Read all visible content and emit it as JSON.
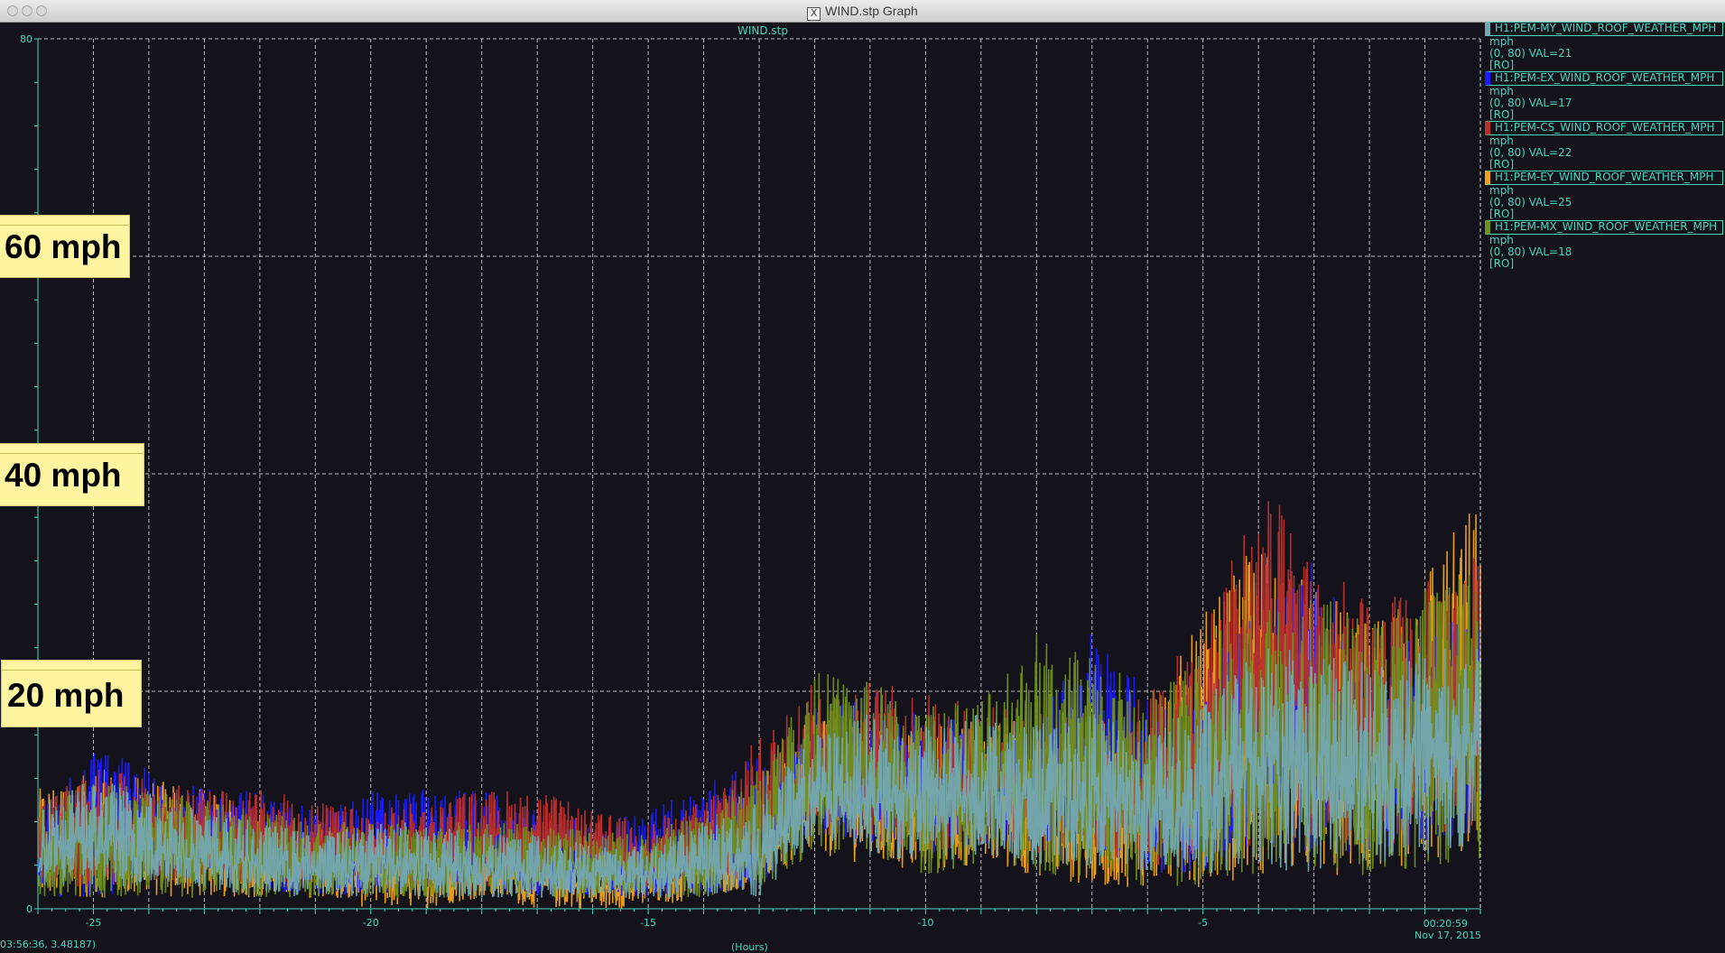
{
  "window": {
    "title": "WIND.stp Graph",
    "x_icon": "X"
  },
  "colors": {
    "background": "#14131c",
    "axis_text": "#48d6bd",
    "grid": "#d8d8d8",
    "series_MY": "#73a8b2",
    "series_EX": "#1a1aff",
    "series_CS": "#b8302c",
    "series_EY": "#f0a21c",
    "series_MX": "#6f8f1e"
  },
  "chart_data": {
    "type": "line",
    "title": "WIND.stp",
    "xlabel": "(Hours)",
    "ylabel": "",
    "xlim": [
      -26,
      0
    ],
    "ylim": [
      0,
      80
    ],
    "x_ticks": [
      -25,
      -20,
      -15,
      -10,
      -5
    ],
    "y_ticks_labeled": [
      0,
      80
    ],
    "grid": true,
    "grid_style": "dashed",
    "legend_position": "right",
    "time_label_right": "00:20:59",
    "date_label": "Nov 17, 2015",
    "cursor_readout": "03:56:36, 3.48187)",
    "series": [
      {
        "name": "H1:PEM-MY_WIND_ROOF_WEATHER_MPH",
        "unit": "mph",
        "range": "(0, 80) VAL=21",
        "mode": "[RO]",
        "color": "#73a8b2",
        "x": [
          -26,
          -25,
          -24,
          -23,
          -22,
          -21,
          -20,
          -19,
          -18,
          -17,
          -16,
          -15,
          -14,
          -13,
          -12,
          -11,
          -10,
          -9,
          -8,
          -7,
          -6,
          -5,
          -4,
          -3,
          -2,
          -1,
          0
        ],
        "lo": [
          2,
          2,
          2,
          2,
          1,
          1,
          1,
          1,
          1,
          1,
          1,
          1,
          1,
          1,
          6,
          5,
          4,
          5,
          4,
          4,
          3,
          3,
          4,
          3,
          4,
          5,
          6
        ],
        "hi": [
          10,
          12,
          11,
          9,
          8,
          7,
          8,
          8,
          7,
          7,
          6,
          6,
          8,
          10,
          16,
          18,
          17,
          18,
          17,
          18,
          16,
          19,
          25,
          24,
          23,
          24,
          24
        ]
      },
      {
        "name": "H1:PEM-EX_WIND_ROOF_WEATHER_MPH",
        "unit": "mph",
        "range": "(0, 80) VAL=17",
        "mode": "[RO]",
        "color": "#1a1aff",
        "x": [
          -26,
          -25,
          -24,
          -23,
          -22,
          -21,
          -20,
          -19,
          -18,
          -17,
          -16,
          -15,
          -14,
          -13,
          -12,
          -11,
          -10,
          -9,
          -8,
          -7,
          -6,
          -5,
          -4,
          -3,
          -2,
          -1,
          0
        ],
        "lo": [
          1,
          1,
          2,
          3,
          2,
          1,
          1,
          2,
          2,
          1,
          1,
          1,
          1,
          2,
          7,
          6,
          5,
          6,
          6,
          6,
          3,
          3,
          6,
          5,
          5,
          6,
          7
        ],
        "hi": [
          9,
          15,
          13,
          11,
          11,
          9,
          11,
          11,
          11,
          9,
          8,
          9,
          12,
          14,
          19,
          20,
          18,
          17,
          17,
          26,
          20,
          22,
          28,
          32,
          25,
          26,
          27
        ]
      },
      {
        "name": "H1:PEM-CS_WIND_ROOF_WEATHER_MPH",
        "unit": "mph",
        "range": "(0, 80) VAL=22",
        "mode": "[RO]",
        "color": "#b8302c",
        "x": [
          -26,
          -25,
          -24,
          -23,
          -22,
          -21,
          -20,
          -19,
          -18,
          -17,
          -16,
          -15,
          -14,
          -13,
          -12,
          -11,
          -10,
          -9,
          -8,
          -7,
          -6,
          -5,
          -4,
          -3,
          -2,
          -1,
          0
        ],
        "lo": [
          2,
          2,
          2,
          3,
          2,
          2,
          2,
          2,
          2,
          2,
          2,
          2,
          2,
          3,
          7,
          6,
          5,
          6,
          5,
          5,
          4,
          4,
          6,
          6,
          6,
          6,
          7
        ],
        "hi": [
          10,
          13,
          12,
          11,
          11,
          10,
          9,
          10,
          11,
          11,
          9,
          8,
          10,
          16,
          21,
          21,
          20,
          19,
          18,
          18,
          20,
          26,
          40,
          33,
          28,
          30,
          33
        ]
      },
      {
        "name": "H1:PEM-EY_WIND_ROOF_WEATHER_MPH",
        "unit": "mph",
        "range": "(0, 80) VAL=25",
        "mode": "[RO]",
        "color": "#f0a21c",
        "x": [
          -26,
          -25,
          -24,
          -23,
          -22,
          -21,
          -20,
          -19,
          -18,
          -17,
          -16,
          -15,
          -14,
          -13,
          -12,
          -11,
          -10,
          -9,
          -8,
          -7,
          -6,
          -5,
          -4,
          -3,
          -2,
          -1,
          0
        ],
        "lo": [
          1,
          1,
          1,
          1,
          1,
          1,
          0,
          0,
          1,
          0,
          0,
          0,
          1,
          2,
          5,
          4,
          3,
          4,
          3,
          2,
          2,
          2,
          3,
          3,
          3,
          4,
          5
        ],
        "hi": [
          11,
          13,
          12,
          11,
          9,
          8,
          7,
          7,
          8,
          7,
          5,
          6,
          9,
          12,
          19,
          18,
          17,
          18,
          16,
          15,
          18,
          27,
          34,
          30,
          26,
          32,
          38
        ]
      },
      {
        "name": "H1:PEM-MX_WIND_ROOF_WEATHER_MPH",
        "unit": "mph",
        "range": "(0, 80) VAL=18",
        "mode": "[RO]",
        "color": "#6f8f1e",
        "x": [
          -26,
          -25,
          -24,
          -23,
          -22,
          -21,
          -20,
          -19,
          -18,
          -17,
          -16,
          -15,
          -14,
          -13,
          -12,
          -11,
          -10,
          -9,
          -8,
          -7,
          -6,
          -5,
          -4,
          -3,
          -2,
          -1,
          0
        ],
        "lo": [
          1,
          1,
          1,
          1,
          1,
          1,
          1,
          1,
          1,
          1,
          1,
          1,
          1,
          2,
          5,
          5,
          3,
          4,
          3,
          3,
          2,
          2,
          3,
          3,
          3,
          4,
          4
        ],
        "hi": [
          10,
          12,
          11,
          10,
          9,
          8,
          8,
          8,
          8,
          8,
          7,
          7,
          9,
          13,
          22,
          21,
          19,
          20,
          26,
          24,
          20,
          24,
          30,
          29,
          27,
          30,
          31
        ]
      }
    ]
  },
  "annotations": [
    {
      "text": "60 mph"
    },
    {
      "text": "40 mph"
    },
    {
      "text": "20 mph"
    }
  ]
}
